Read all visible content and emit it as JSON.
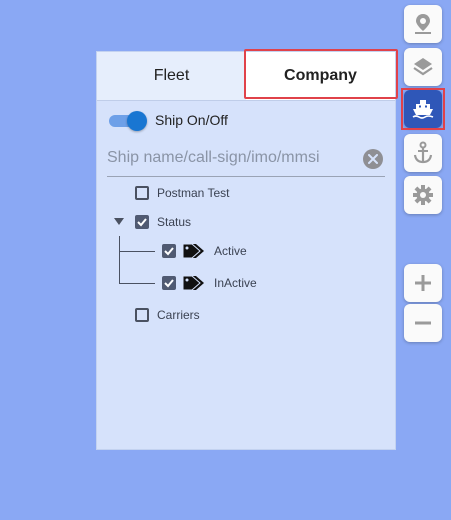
{
  "tabs": {
    "fleet": "Fleet",
    "company": "Company"
  },
  "toggle": {
    "label": "Ship On/Off",
    "on": true
  },
  "search": {
    "placeholder": "Ship name/call-sign/imo/mmsi"
  },
  "tree": {
    "items": [
      {
        "label": "Postman Test",
        "checked": false
      },
      {
        "label": "Status",
        "checked": true,
        "expanded": true,
        "children": [
          {
            "label": "Active",
            "checked": true,
            "icon": "tags-icon"
          },
          {
            "label": "InActive",
            "checked": true,
            "icon": "tags-icon"
          }
        ]
      },
      {
        "label": "Carriers",
        "checked": false
      }
    ]
  },
  "toolbar": {
    "buttons": [
      {
        "name": "location-pin-icon",
        "active": false
      },
      {
        "name": "layers-icon",
        "active": false
      },
      {
        "name": "ship-icon",
        "active": true
      },
      {
        "name": "anchor-icon",
        "active": false
      },
      {
        "name": "gear-icon",
        "active": false
      },
      {
        "name": "zoom-in-icon",
        "active": false
      },
      {
        "name": "zoom-out-icon",
        "active": false
      }
    ]
  },
  "colors": {
    "background": "#8aa8f4",
    "panel": "#d6e2fb",
    "accent": "#1976d2",
    "highlight": "#e0424a"
  }
}
